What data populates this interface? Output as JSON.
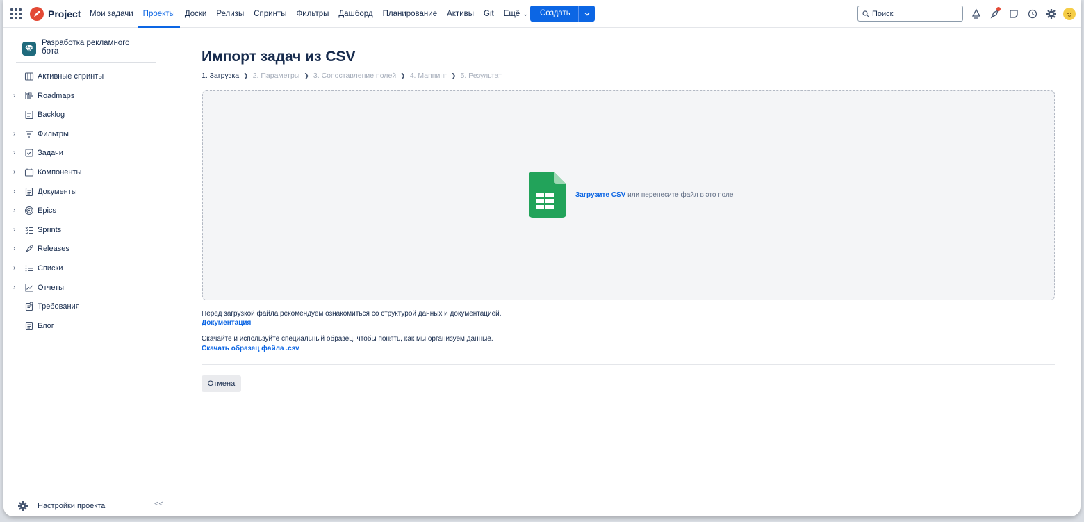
{
  "header": {
    "brand": "Project",
    "nav": [
      "Мои задачи",
      "Проекты",
      "Доски",
      "Релизы",
      "Спринты",
      "Фильтры",
      "Дашборд",
      "Планирование",
      "Активы",
      "Git",
      "Ещё"
    ],
    "active_nav": "Проекты",
    "create_label": "Создать",
    "search_placeholder": "Поиск",
    "accent": "#0c66e4"
  },
  "sidebar": {
    "project_name": "Разработка рекламного бота",
    "items": [
      {
        "label": "Активные спринты",
        "icon": "board-columns-icon",
        "expandable": false
      },
      {
        "label": "Roadmaps",
        "icon": "roadmap-icon",
        "expandable": true
      },
      {
        "label": "Backlog",
        "icon": "backlog-icon",
        "expandable": false
      },
      {
        "label": "Фильтры",
        "icon": "filter-icon",
        "expandable": true
      },
      {
        "label": "Задачи",
        "icon": "task-check-icon",
        "expandable": true
      },
      {
        "label": "Компоненты",
        "icon": "component-icon",
        "expandable": true
      },
      {
        "label": "Документы",
        "icon": "document-icon",
        "expandable": true
      },
      {
        "label": "Epics",
        "icon": "epic-target-icon",
        "expandable": true
      },
      {
        "label": "Sprints",
        "icon": "sprint-list-icon",
        "expandable": true
      },
      {
        "label": "Releases",
        "icon": "rocket-icon",
        "expandable": true
      },
      {
        "label": "Списки",
        "icon": "list-icon",
        "expandable": true
      },
      {
        "label": "Отчеты",
        "icon": "chart-line-icon",
        "expandable": true
      },
      {
        "label": "Требования",
        "icon": "requirements-icon",
        "expandable": false
      },
      {
        "label": "Блог",
        "icon": "blog-icon",
        "expandable": false
      }
    ],
    "settings_label": "Настройки проекта",
    "collapse_glyph": "<<"
  },
  "main": {
    "title": "Импорт задач из CSV",
    "steps": [
      "1. Загрузка",
      "2. Параметры",
      "3. Сопоставление полей",
      "4. Маппинг",
      "5. Результат"
    ],
    "current_step": 0,
    "dropzone": {
      "link": "Загрузите CSV",
      "text": " или перенесите файл в это поле"
    },
    "info1": "Перед загрузкой файла рекомендуем ознакомиться со структурой данных и документацией.",
    "link1": "Документация",
    "info2": "Скачайте и используйте специальный образец, чтобы понять, как мы организуем данные.",
    "link2": "Скачать образец файла .csv",
    "cancel_label": "Отмена"
  }
}
